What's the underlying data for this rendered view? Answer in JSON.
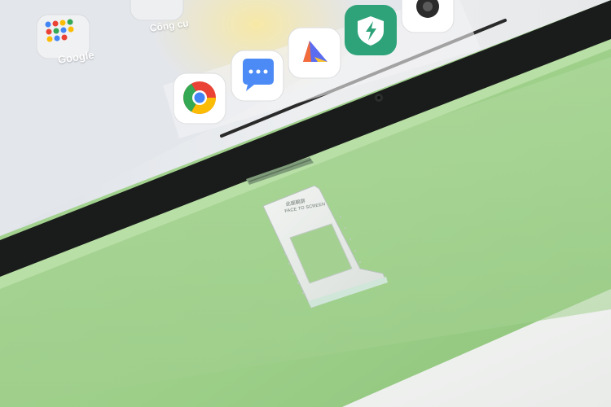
{
  "screen": {
    "labels": {
      "google_folder": "Google",
      "tools_folder": "Công cụ"
    },
    "dock_icons": [
      "chrome-icon",
      "messages-icon",
      "arc-search-icon",
      "pc-manager-icon",
      "camera-icon"
    ]
  },
  "sim_tray": {
    "text_cn": "此面朝屏",
    "text_en": "FACE TO SCREEN"
  },
  "colors": {
    "tablet_body": "#a8d596",
    "table_surface": "#9fcf8c",
    "bezel": "#1a1c1b",
    "screen_bg": "#e4e6ea",
    "tray_metal": "#e7ebe8"
  }
}
